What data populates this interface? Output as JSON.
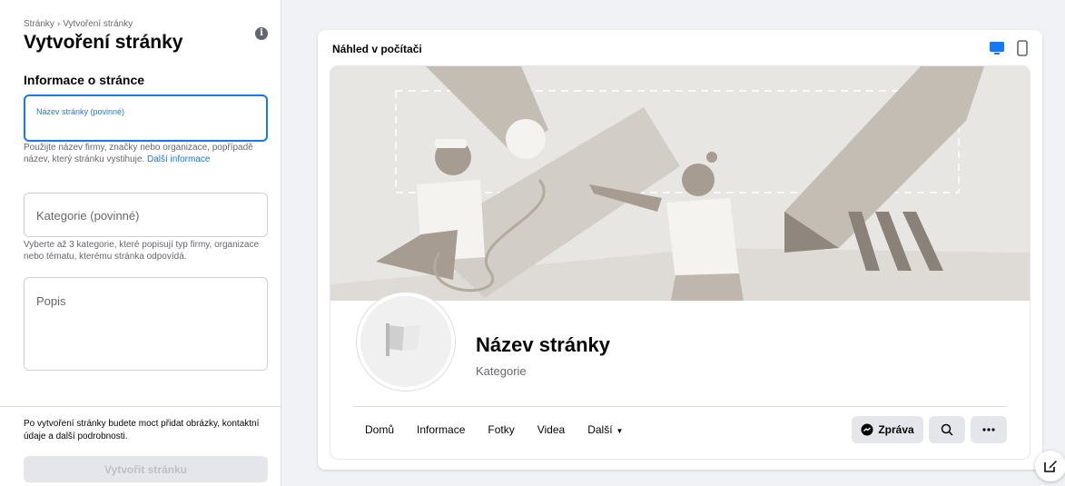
{
  "sidebar": {
    "breadcrumb": {
      "parent": "Stránky",
      "separator": "›",
      "current": "Vytvoření stránky"
    },
    "title": "Vytvoření stránky",
    "section_title": "Informace o stránce",
    "name_field": {
      "label": "Název stránky (povinné)",
      "value": ""
    },
    "name_help": "Použijte název firmy, značky nebo organizace, popřípadě název, který stránku vystihuje.",
    "name_help_link": "Další informace",
    "category_field": {
      "placeholder": "Kategorie (povinné)"
    },
    "category_help": "Vyberte až 3 kategorie, které popisují typ firmy, organizace nebo tématu, kterému stránka odpovídá.",
    "description_field": {
      "placeholder": "Popis"
    },
    "footer_note": "Po vytvoření stránky budete moct přidat obrázky, kontaktní údaje a další podrobnosti.",
    "create_button": "Vytvořit stránku"
  },
  "preview": {
    "title": "Náhled v počítači",
    "active_device": "desktop",
    "page_name": "Název stránky",
    "page_category": "Kategorie",
    "nav": [
      "Domů",
      "Informace",
      "Fotky",
      "Videa",
      "Další"
    ],
    "message_button": "Zpráva"
  },
  "colors": {
    "accent": "#1877f2",
    "cover_bg": "#e8e6e3",
    "button_bg": "#e4e6eb"
  },
  "icons": {
    "info": "info-icon",
    "desktop": "desktop-icon",
    "mobile": "mobile-icon",
    "messenger": "messenger-icon",
    "search": "search-icon",
    "more": "more-icon",
    "compose": "compose-icon",
    "flag": "flag-icon"
  }
}
